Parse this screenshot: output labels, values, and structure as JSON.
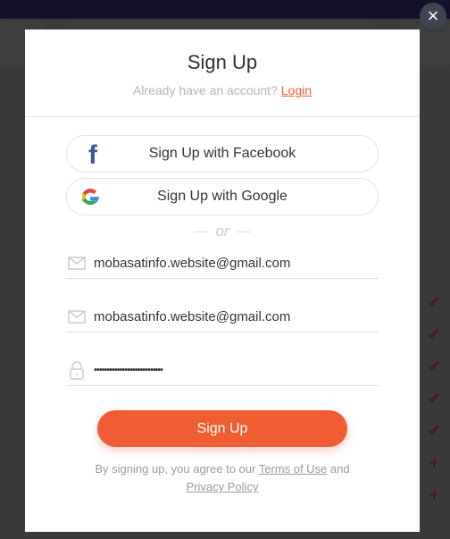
{
  "modal": {
    "title": "Sign Up",
    "subtitle": "Already have an account?",
    "login_link": "Login",
    "facebook_button": "Sign Up with Facebook",
    "google_button": "Sign Up with Google",
    "divider": "or",
    "email_value": "mobasatinfo.website@gmail.com",
    "confirm_email_value": "mobasatinfo.website@gmail.com",
    "password_value": "•••••••••••••••••••••••••••",
    "submit_button": "Sign Up",
    "terms_prefix": "By signing up, you agree to our",
    "terms_link": "Terms of Use",
    "terms_and": "and",
    "privacy_link": "Privacy Policy"
  },
  "close_icon": "×",
  "background_marks": [
    "✔",
    "✔",
    "✔",
    "✔",
    "✔",
    "+",
    "+"
  ],
  "colors": {
    "accent": "#f05d33",
    "facebook": "#3b5998",
    "overlay": "#3a3a3a"
  }
}
